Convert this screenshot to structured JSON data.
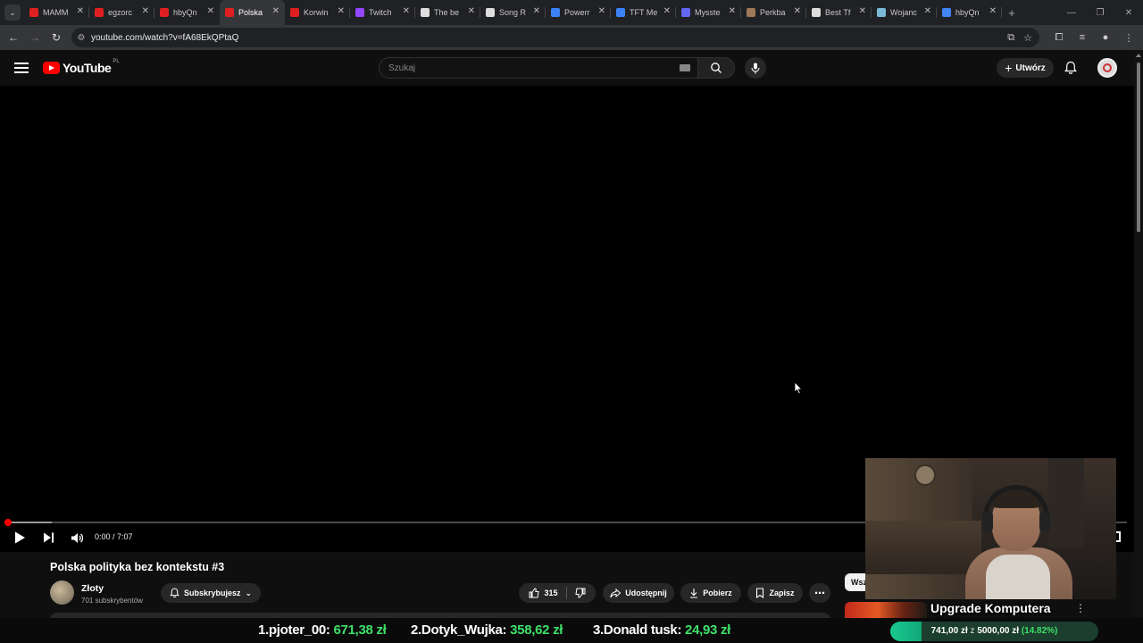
{
  "browser": {
    "tabs": [
      {
        "title": "MAMM",
        "color": "#e02020"
      },
      {
        "title": "egzorc",
        "color": "#e02020"
      },
      {
        "title": "hbyQn",
        "color": "#e02020"
      },
      {
        "title": "Polska",
        "color": "#e02020"
      },
      {
        "title": "Korwin",
        "color": "#e02020"
      },
      {
        "title": "Twitch",
        "color": "#9146ff"
      },
      {
        "title": "The be",
        "color": "#dddddd"
      },
      {
        "title": "Song R",
        "color": "#dddddd"
      },
      {
        "title": "Powerr",
        "color": "#3b82f6"
      },
      {
        "title": "TFT Me",
        "color": "#3b82f6"
      },
      {
        "title": "Mysste",
        "color": "#6366f1"
      },
      {
        "title": "Perkba",
        "color": "#a0785a"
      },
      {
        "title": "Best Tf",
        "color": "#dddddd"
      },
      {
        "title": "Wojanc",
        "color": "#7ab8d8"
      },
      {
        "title": "hbyQn",
        "color": "#4285f4"
      }
    ],
    "active_tab_index": 3,
    "url": "youtube.com/watch?v=fA68EkQPtaQ"
  },
  "youtube": {
    "logo_text": "YouTube",
    "country_code": "PL",
    "search_placeholder": "Szukaj",
    "create_label": "Utwórz"
  },
  "player": {
    "time": "0:00 / 7:07",
    "progress_fraction": 0.0,
    "buffered_fraction": 0.04
  },
  "video": {
    "title": "Polska polityka bez kontekstu #3",
    "channel_name": "Złoty",
    "subscribers": "701 subskrybentów",
    "subscribe_label": "Subskrybujesz",
    "likes": "315",
    "share_label": "Udostępnij",
    "download_label": "Pobierz",
    "save_label": "Zapisz"
  },
  "sidebar": {
    "chip_label": "Wsz"
  },
  "overlay": {
    "upgrade_title": "Upgrade Komputera",
    "donations": [
      {
        "rank": "1.",
        "name": "pjoter_00:",
        "amount": "671,38 zł"
      },
      {
        "rank": "2.",
        "name": "Dotyk_Wujka:",
        "amount": "358,62 zł"
      },
      {
        "rank": "3.",
        "name": "Donald tusk:",
        "amount": "24,93 zł"
      }
    ],
    "goal": {
      "current": "741,00 zł",
      "joiner": "z",
      "target": "5000,00 zł",
      "percent_text": "(14.82%)",
      "fraction": 0.1482
    }
  },
  "colors": {
    "accent_red": "#ff0000",
    "donation_green": "#3ee06a",
    "goal_bar": "#19c98e"
  }
}
